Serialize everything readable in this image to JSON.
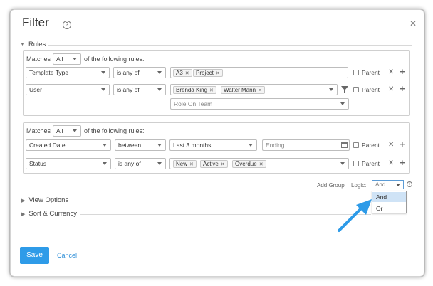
{
  "dialog": {
    "title": "Filter"
  },
  "rules_section": {
    "label": "Rules"
  },
  "groups": [
    {
      "matches_label": "Matches",
      "matches_value": "All",
      "following_label": "of the following rules:",
      "rules": [
        {
          "field": "Template Type",
          "operator": "is any of",
          "tags": [
            "A3",
            "Project"
          ],
          "parent_label": "Parent"
        },
        {
          "field": "User",
          "operator": "is any of",
          "tags": [
            "Brenda King",
            "Walter Mann"
          ],
          "parent_label": "Parent",
          "sub_placeholder": "Role On Team"
        }
      ]
    },
    {
      "matches_label": "Matches",
      "matches_value": "All",
      "following_label": "of the following rules:",
      "rules": [
        {
          "field": "Created Date",
          "operator": "between",
          "range": "Last 3 months",
          "end_placeholder": "Ending",
          "parent_label": "Parent"
        },
        {
          "field": "Status",
          "operator": "is any of",
          "tags": [
            "New",
            "Active",
            "Overdue"
          ],
          "parent_label": "Parent"
        }
      ]
    }
  ],
  "footer_controls": {
    "add_group_label": "Add Group",
    "logic_label": "Logic:",
    "logic_value": "And",
    "logic_options": [
      "And",
      "Or"
    ]
  },
  "sections": {
    "view_options": "View Options",
    "sort_currency": "Sort & Currency"
  },
  "actions": {
    "save": "Save",
    "cancel": "Cancel"
  },
  "icons": {
    "help": "question-circle-icon",
    "close": "close-icon",
    "remove": "remove-x-icon",
    "add": "plus-icon",
    "filter": "funnel-icon",
    "calendar": "calendar-icon",
    "info": "info-icon",
    "annotation_arrow": "arrow-icon"
  },
  "colors": {
    "primary": "#2e9be8",
    "link": "#2e8fd8",
    "highlight": "#cfe3f6",
    "arrow": "#2e9be8"
  }
}
